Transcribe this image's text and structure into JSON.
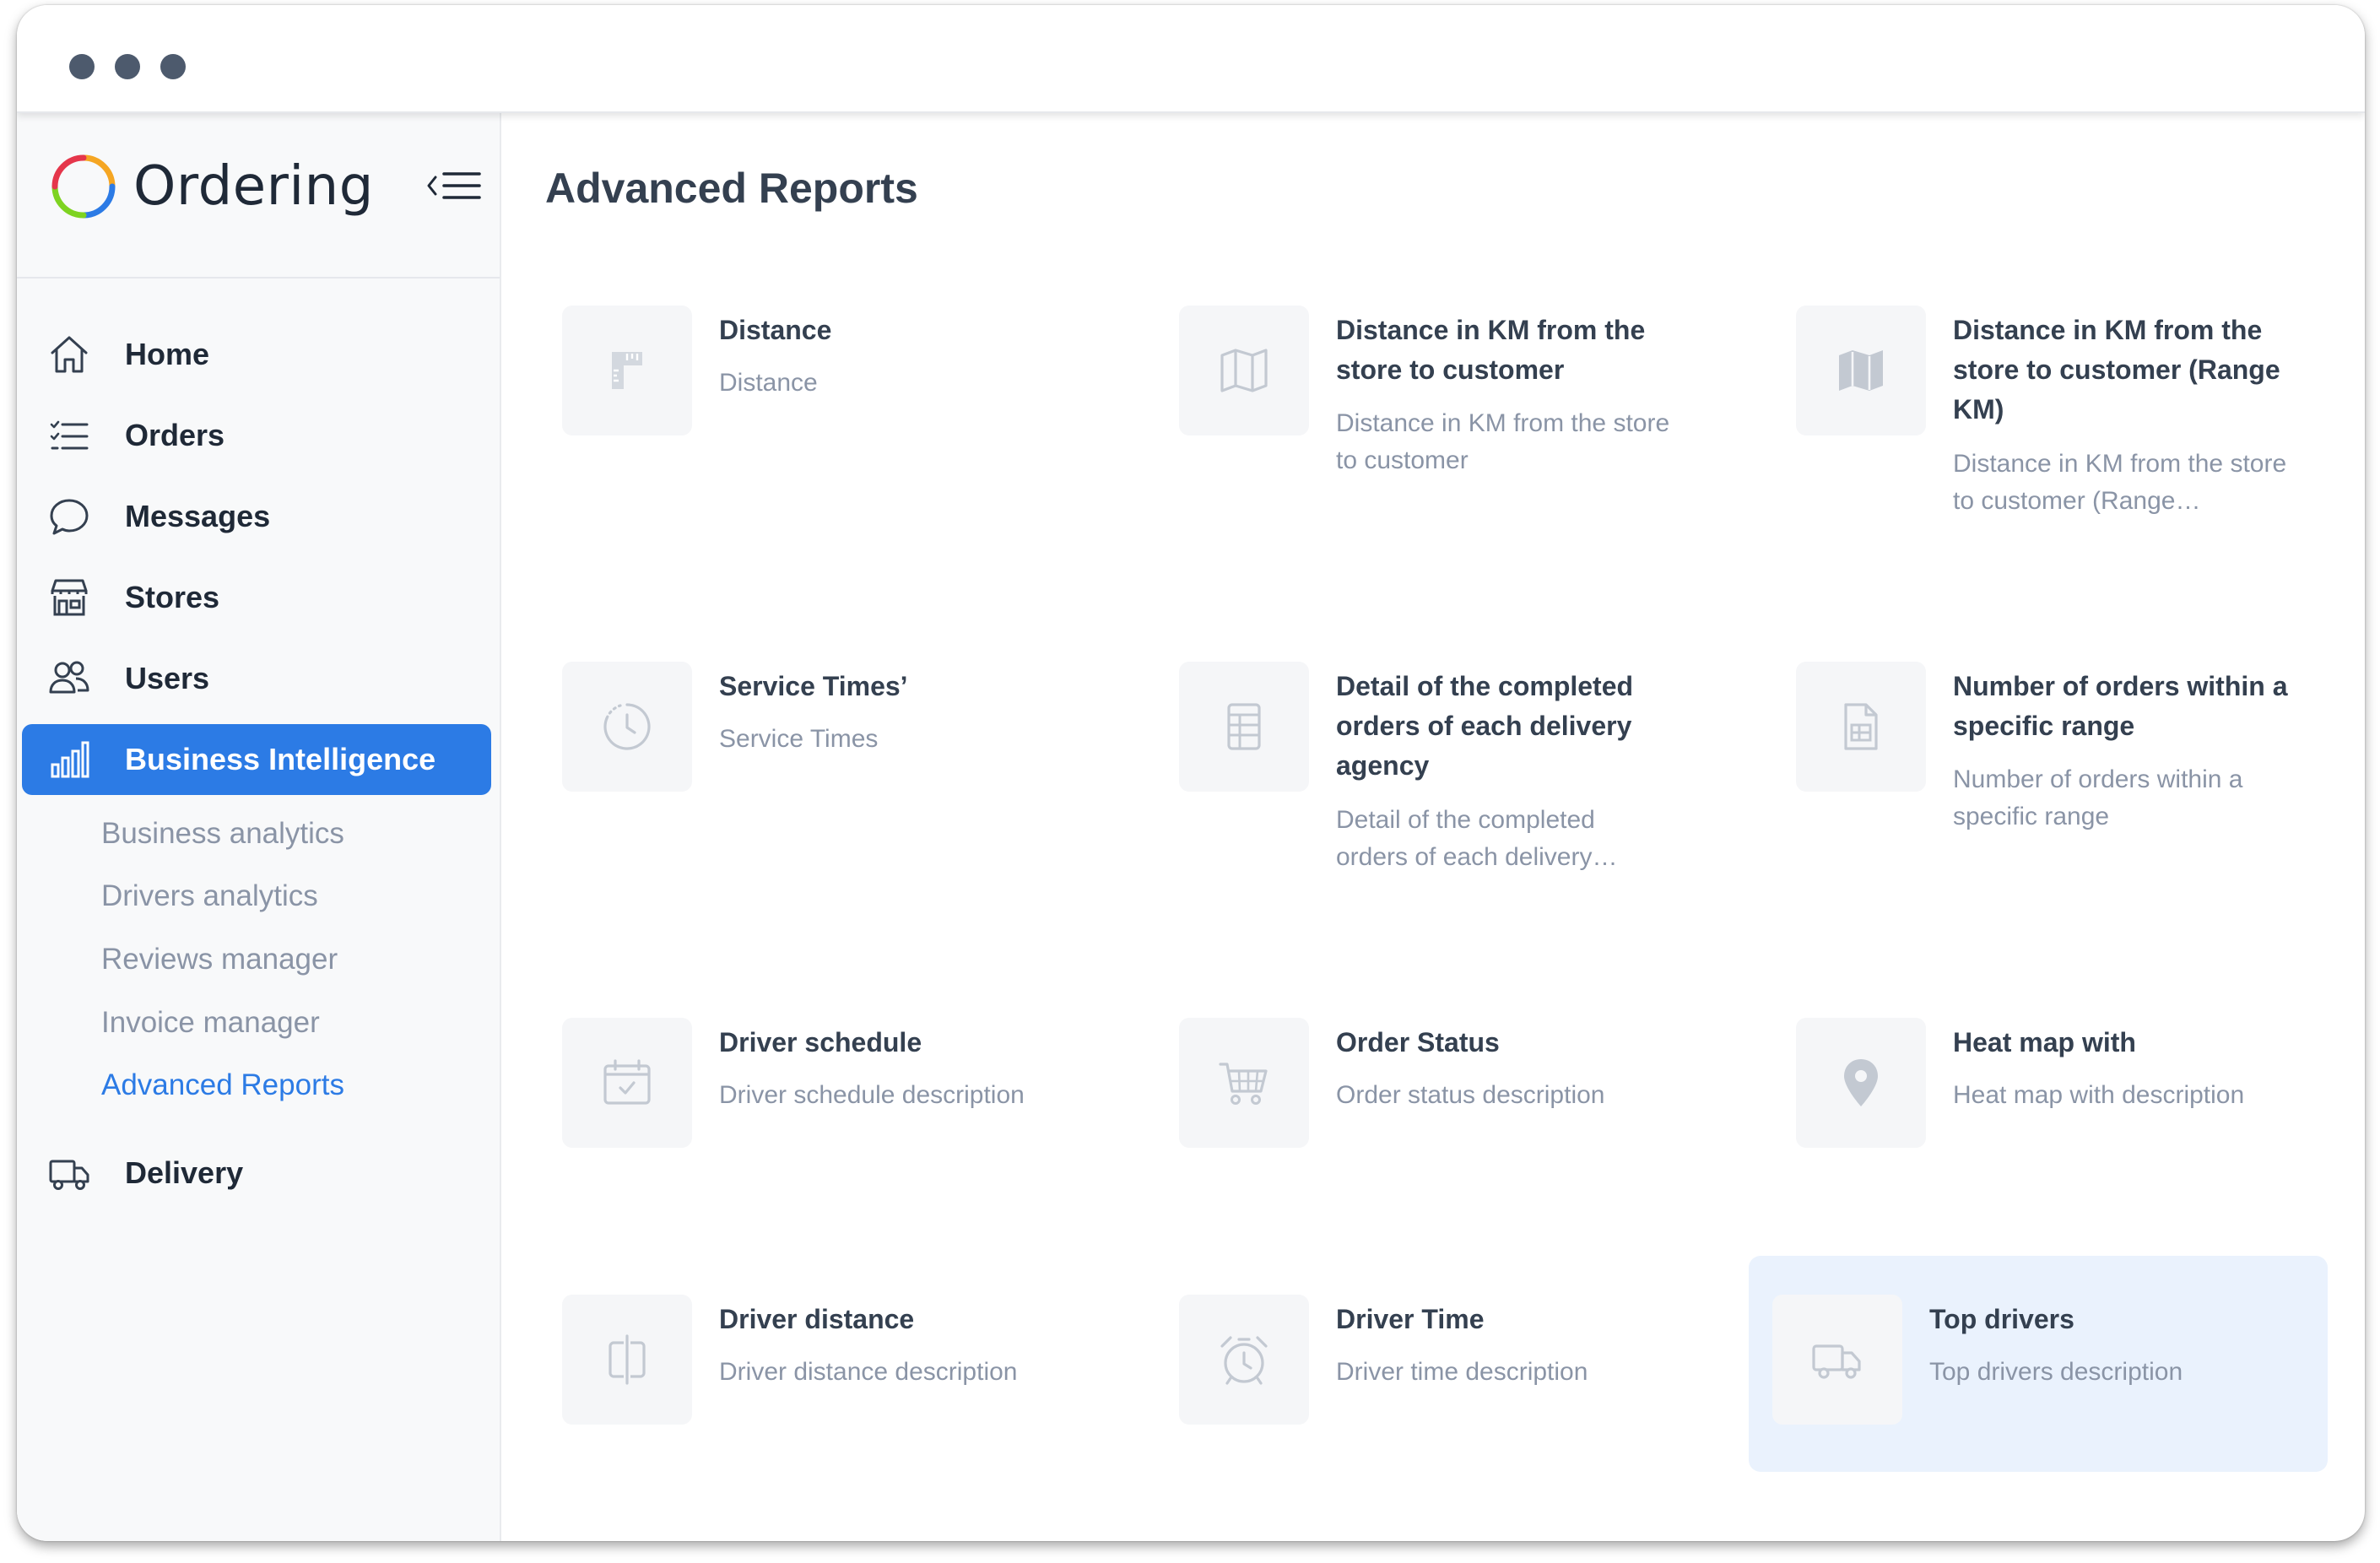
{
  "app": {
    "brand_name": "Ordering"
  },
  "colors": {
    "accent": "#2c7be5",
    "sidebar_bg": "#f8f9fa",
    "tile_bg": "#f5f6f8",
    "highlight_bg": "#eaf2fd",
    "muted_text": "#8a94a6"
  },
  "sidebar": {
    "collapse_icon": "collapse-menu-icon",
    "items": [
      {
        "label": "Home",
        "icon": "home-icon"
      },
      {
        "label": "Orders",
        "icon": "list-icon"
      },
      {
        "label": "Messages",
        "icon": "chat-bubble-icon"
      },
      {
        "label": "Stores",
        "icon": "storefront-icon"
      },
      {
        "label": "Users",
        "icon": "users-icon"
      },
      {
        "label": "Business Intelligence",
        "icon": "bar-chart-icon",
        "active": true
      },
      {
        "label": "Delivery",
        "icon": "truck-icon"
      }
    ],
    "submenu": [
      {
        "label": "Business analytics"
      },
      {
        "label": "Drivers analytics"
      },
      {
        "label": "Reviews manager"
      },
      {
        "label": "Invoice manager"
      },
      {
        "label": "Advanced Reports",
        "current": true
      }
    ]
  },
  "main": {
    "title": "Advanced Reports",
    "reports": [
      {
        "title": "Distance",
        "description": "Distance",
        "icon": "ruler-icon"
      },
      {
        "title": "Distance in KM from the store to customer",
        "description": "Distance in KM from the store to customer",
        "icon": "map-outline-icon"
      },
      {
        "title": "Distance in KM from the store to customer (Range KM)",
        "description": "Distance in KM from the store to customer (Range…",
        "icon": "map-filled-icon"
      },
      {
        "title": "Service Times’",
        "description": "Service Times",
        "icon": "clock-icon"
      },
      {
        "title": "Detail of the completed orders of each delivery agency",
        "description": "Detail of the completed orders of each delivery…",
        "icon": "table-icon"
      },
      {
        "title": "Number of orders within a specific range",
        "description": "Number of orders within a specific range",
        "icon": "document-icon"
      },
      {
        "title": "Driver schedule",
        "description": "Driver schedule description",
        "icon": "calendar-check-icon"
      },
      {
        "title": "Order Status",
        "description": "Order status description",
        "icon": "cart-icon"
      },
      {
        "title": "Heat map with",
        "description": "Heat map with description",
        "icon": "map-pin-icon"
      },
      {
        "title": "Driver distance",
        "description": "Driver distance description",
        "icon": "split-distance-icon"
      },
      {
        "title": "Driver Time",
        "description": "Driver time description",
        "icon": "alarm-clock-icon"
      },
      {
        "title": "Top drivers",
        "description": "Top drivers description",
        "icon": "truck-icon",
        "highlighted": true
      }
    ]
  }
}
